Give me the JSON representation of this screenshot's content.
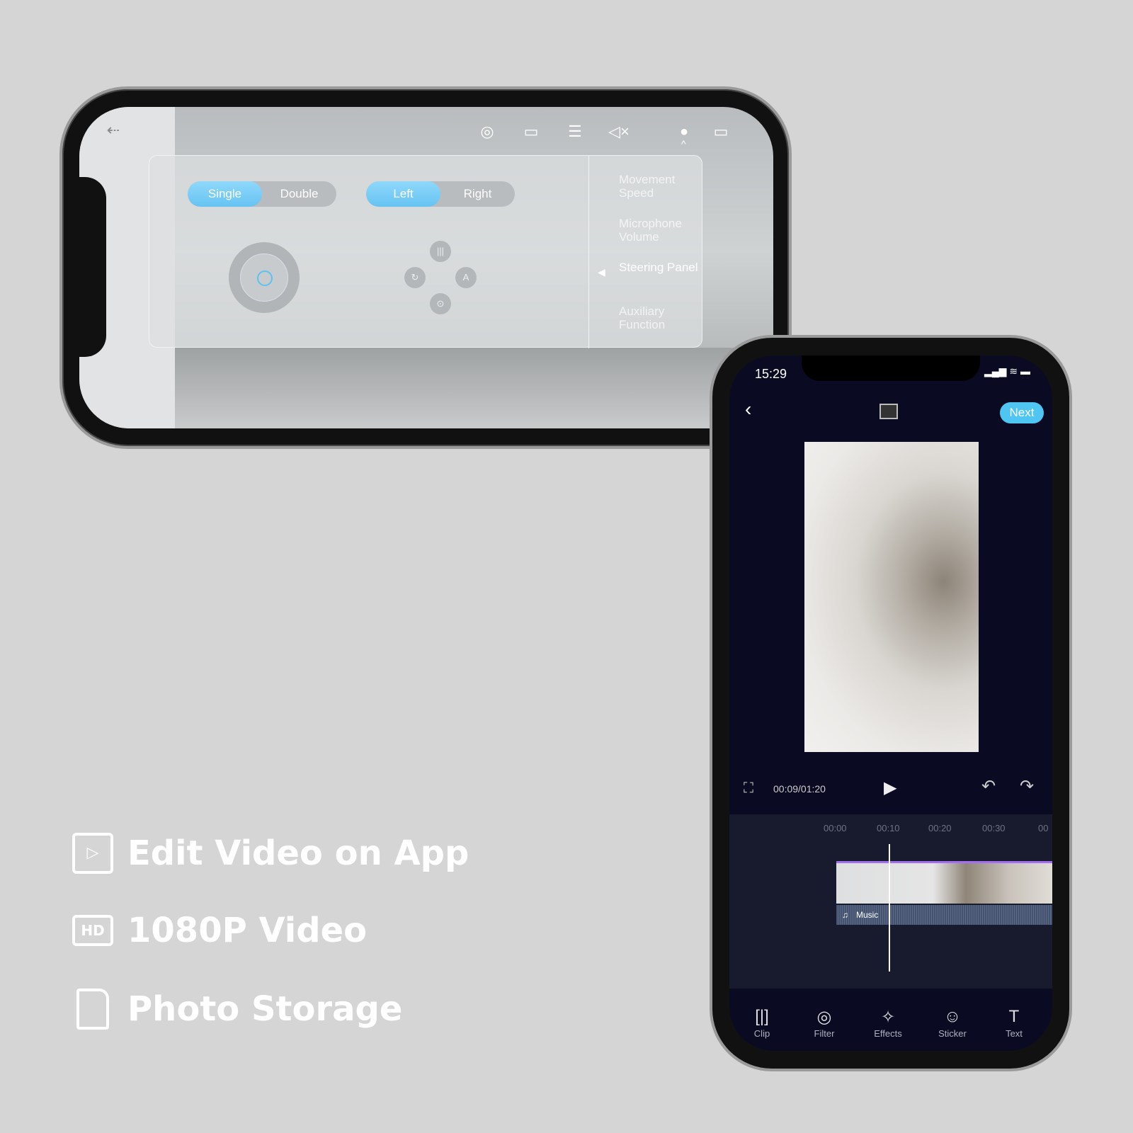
{
  "landscape_app": {
    "top_icons": [
      "exit-icon",
      "camera-icon",
      "video-record-icon",
      "list-icon",
      "mute-icon",
      "robot-avatar-icon",
      "battery-icon"
    ],
    "mode_toggle": {
      "options": [
        "Single",
        "Double"
      ],
      "selected": "Single"
    },
    "hand_toggle": {
      "options": [
        "Left",
        "Right"
      ],
      "selected": "Left"
    },
    "menu": [
      "Movement Speed",
      "Microphone Volume",
      "Steering Panel",
      "Auxiliary Function"
    ],
    "menu_selected": "Steering Panel",
    "accent": "#66c3f2"
  },
  "portrait_app": {
    "status_time": "15:29",
    "next_label": "Next",
    "playback_time": "00:09/01:20",
    "timeline_ticks": [
      "00:00",
      "00:10",
      "00:20",
      "00:30",
      "00"
    ],
    "music_label": "Music",
    "tools": [
      {
        "label": "Clip",
        "icon": "clip-icon"
      },
      {
        "label": "Filter",
        "icon": "filter-icon"
      },
      {
        "label": "Effects",
        "icon": "effects-icon"
      },
      {
        "label": "Sticker",
        "icon": "sticker-icon"
      },
      {
        "label": "Text",
        "icon": "text-icon"
      }
    ],
    "accent": "#4fc6f2",
    "background": "#0a0b22"
  },
  "features": [
    "Edit Video on App",
    "1080P Video",
    "Photo Storage"
  ]
}
